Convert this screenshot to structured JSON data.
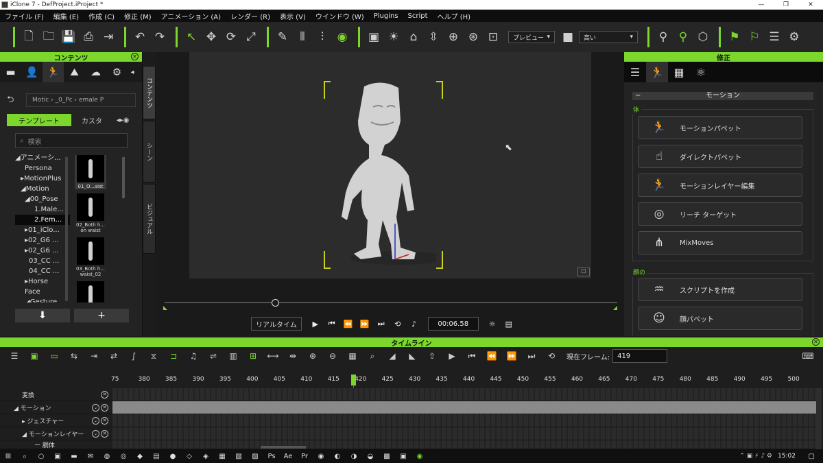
{
  "window": {
    "title": "iClone 7 - DefProject.iProject *",
    "controls": [
      "—",
      "❐",
      "✕"
    ]
  },
  "menu": [
    "ファイル (F)",
    "編集 (E)",
    "作成 (C)",
    "修正 (M)",
    "アニメーション (A)",
    "レンダー (R)",
    "表示 (V)",
    "ウインドウ (W)",
    "Plugins",
    "Script",
    "ヘルプ (H)"
  ],
  "toolbar": {
    "preview_dropdown": "プレビュー",
    "quality_dropdown": "高い"
  },
  "content_panel": {
    "title": "コンテンツ",
    "breadcrumb": "Motic › _0_Pc › emale P",
    "tab_template": "テンプレート",
    "tab_custom": "カスタ",
    "search_placeholder": "検索",
    "tree": [
      "◢アニメーシ...",
      "Persona",
      "▸MotionPlus",
      "◢Motion",
      "◢00_Pose",
      "1.Male...",
      "2.Fem...",
      "▸01_iClo...",
      "▸02_G6 ...",
      "▸02_G6 ...",
      "03_CC ...",
      "04_CC ...",
      "▸Horse",
      "Face",
      "◢Gesture"
    ],
    "thumbs": [
      {
        "label": "01_O...aist"
      },
      {
        "label": "02_Both h... on waist"
      },
      {
        "label": "03_Both h... waist_02"
      },
      {
        "label": ""
      }
    ],
    "btn_down": "⬇",
    "btn_add": "+"
  },
  "side_tabs": [
    "コンテンツ",
    "シーン",
    "ビジュアル"
  ],
  "viewport": {
    "realtime_label": "リアルタイム",
    "timecode": "00:06.58",
    "scrub_progress": 0.24
  },
  "modify_panel": {
    "title": "修正",
    "section_title": "モーション",
    "group_body_label": "体",
    "body_buttons": [
      "モーションパペット",
      "ダイレクトパペット",
      "モーションレイヤー編集",
      "リーチ ターゲット",
      "MixMoves"
    ],
    "group_face_label": "顔の",
    "face_buttons": [
      "スクリプトを作成",
      "顔パペット"
    ]
  },
  "timeline": {
    "title": "タイムライン",
    "current_frame_label": "現在フレーム:",
    "current_frame": "419",
    "ruler": [
      "75",
      "380",
      "385",
      "390",
      "395",
      "400",
      "405",
      "410",
      "415",
      "420",
      "425",
      "430",
      "435",
      "440",
      "445",
      "450",
      "455",
      "460",
      "465",
      "470",
      "475",
      "480",
      "485",
      "490",
      "495",
      "500"
    ],
    "tracks": [
      "変換",
      "◢ モーション",
      "▸ ジェスチャー",
      "◢ モーションレイヤー",
      "ー 胴体"
    ]
  },
  "taskbar": {
    "clock": "15:02"
  },
  "colors": {
    "accent": "#7bd72b",
    "panel": "#232323",
    "viewport": "#2c2c2c"
  }
}
